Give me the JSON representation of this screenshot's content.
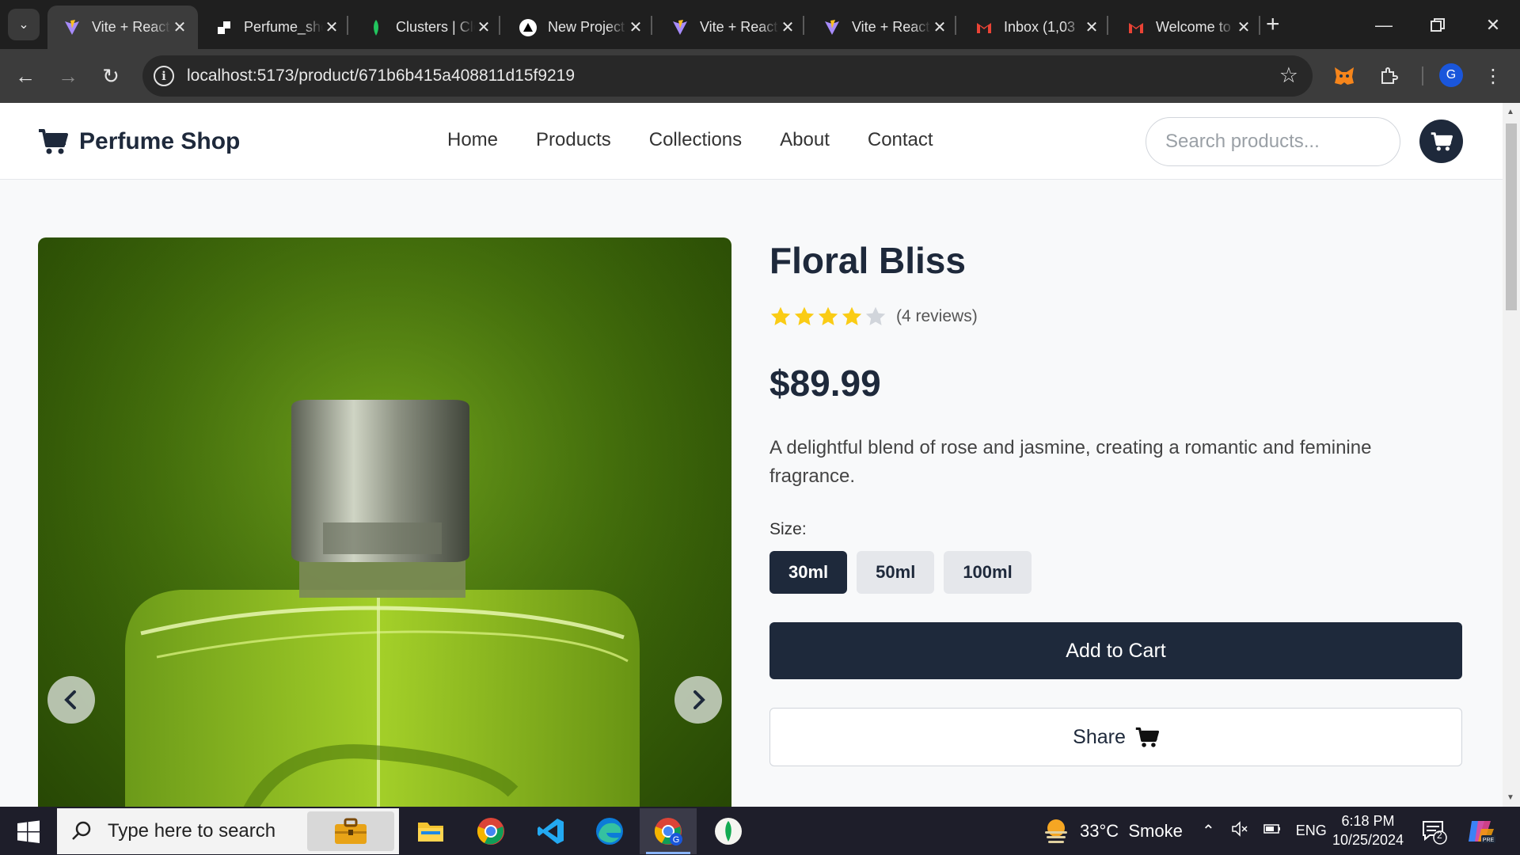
{
  "browser": {
    "tabs": [
      {
        "title": "Vite + React",
        "icon": "vite-icon",
        "active": true
      },
      {
        "title": "Perfume_shop",
        "icon": "perfume-shop-icon",
        "active": false
      },
      {
        "title": "Clusters | Cloud",
        "icon": "mongodb-icon",
        "active": false
      },
      {
        "title": "New Project",
        "icon": "vercel-icon",
        "active": false
      },
      {
        "title": "Vite + React",
        "icon": "vite-icon",
        "active": false
      },
      {
        "title": "Vite + React",
        "icon": "vite-icon",
        "active": false
      },
      {
        "title": "Inbox (1,03",
        "icon": "gmail-icon",
        "active": false
      },
      {
        "title": "Welcome to",
        "icon": "gmail-icon",
        "active": false
      }
    ],
    "url": "localhost:5173/product/671b6b415a408811d15f9219",
    "profile_initial": "G"
  },
  "site": {
    "brand": "Perfume Shop",
    "nav": [
      "Home",
      "Products",
      "Collections",
      "About",
      "Contact"
    ],
    "search_placeholder": "Search products..."
  },
  "product": {
    "name": "Floral Bliss",
    "rating": 4,
    "rating_max": 5,
    "reviews_text": "(4 reviews)",
    "price": "$89.99",
    "description": "A delightful blend of rose and jasmine, creating a romantic and feminine fragrance.",
    "size_label": "Size:",
    "sizes": [
      "30ml",
      "50ml",
      "100ml"
    ],
    "selected_size": "30ml",
    "add_to_cart_label": "Add to Cart",
    "share_label": "Share"
  },
  "colors": {
    "primary": "#1e293b",
    "star_filled": "#facc15",
    "star_empty": "#d1d5db"
  },
  "taskbar": {
    "search_placeholder": "Type here to search",
    "weather": "33°C  Smoke",
    "language": "ENG",
    "time": "6:18 PM",
    "date": "10/25/2024",
    "notification_count": "2"
  }
}
